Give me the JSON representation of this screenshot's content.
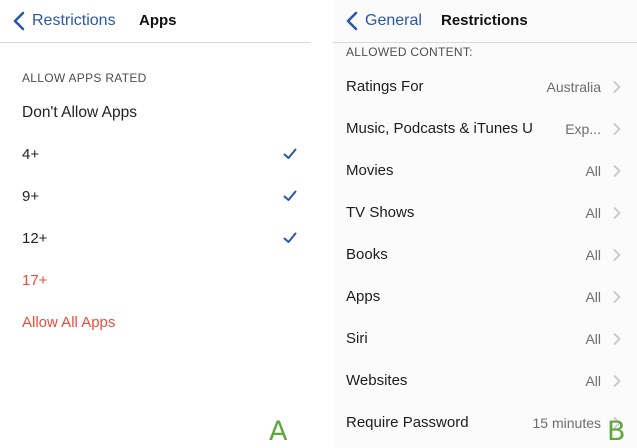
{
  "panel_a": {
    "back_label": "Restrictions",
    "title": "Apps",
    "section_header": "ALLOW APPS RATED",
    "options": [
      {
        "label": "Don't Allow Apps",
        "checked": false,
        "color": "#222222"
      },
      {
        "label": "4+",
        "checked": true,
        "color": "#222222"
      },
      {
        "label": "9+",
        "checked": true,
        "color": "#222222"
      },
      {
        "label": "12+",
        "checked": true,
        "color": "#222222"
      },
      {
        "label": "17+",
        "checked": false,
        "color": "#ee4b3c"
      }
    ],
    "allow_all": "Allow All Apps",
    "corner_letter": "A"
  },
  "panel_b": {
    "back_label": "General",
    "title": "Restrictions",
    "section_header": "ALLOWED CONTENT:",
    "rows": [
      {
        "label": "Ratings For",
        "value": "Australia"
      },
      {
        "label": "Music, Podcasts & iTunes U",
        "value": "Exp..."
      },
      {
        "label": "Movies",
        "value": "All"
      },
      {
        "label": "TV Shows",
        "value": "All"
      },
      {
        "label": "Books",
        "value": "All"
      },
      {
        "label": "Apps",
        "value": "All"
      },
      {
        "label": "Siri",
        "value": "All"
      },
      {
        "label": "Websites",
        "value": "All"
      },
      {
        "label": "Require Password",
        "value": "15 minutes"
      }
    ],
    "corner_letter": "B"
  },
  "colors": {
    "accent_blue": "#2c56a8",
    "disallowed_red": "#ee4b3c",
    "label_green": "#5fa63c",
    "secondary_gray": "#6d6d72"
  },
  "icons": {
    "back": "chevron-left-icon",
    "check": "checkmark-icon",
    "disclosure": "chevron-right-icon"
  }
}
